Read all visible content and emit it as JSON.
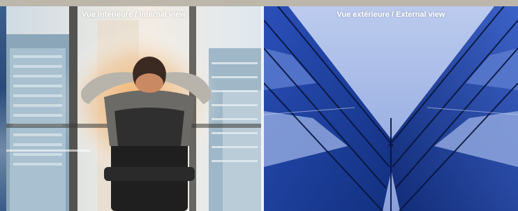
{
  "panels": [
    {
      "caption": "Vue intérieure / Internal view",
      "scene": "person-looking-out-office-window"
    },
    {
      "caption": "Vue extérieure / External view",
      "scene": "glass-skyscraper-looking-up"
    }
  ],
  "colors": {
    "sky_left": "#dfe8ee",
    "sunlight": "#f6b36a",
    "sky_right": "#a7b9e4",
    "glass": "#1c3a9a"
  }
}
